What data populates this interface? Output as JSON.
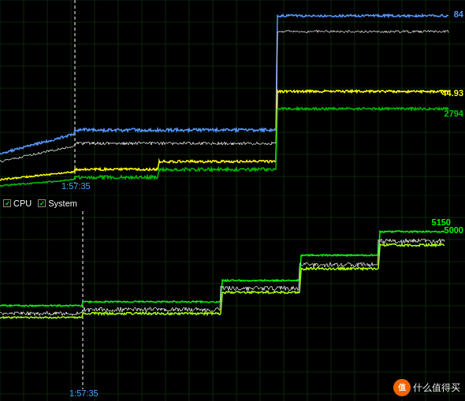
{
  "top_chart": {
    "labels": {
      "blue_value": "84",
      "yellow_value": "44.93",
      "green_value": "2794"
    },
    "timestamp": "1:57:35",
    "grid_color": "#1a3a1a",
    "line_colors": {
      "blue": "#5599ff",
      "white": "#ffffff",
      "yellow": "#ffff00",
      "green": "#00cc00"
    }
  },
  "bottom_chart": {
    "legend": {
      "cpu_label": "CPU",
      "system_label": "System"
    },
    "labels": {
      "green_high": "5150",
      "green_low": "5000"
    },
    "timestamp": "1:57:35",
    "grid_color": "#1a3a1a"
  },
  "watermark": {
    "icon": "值",
    "text": "什么值得买"
  }
}
